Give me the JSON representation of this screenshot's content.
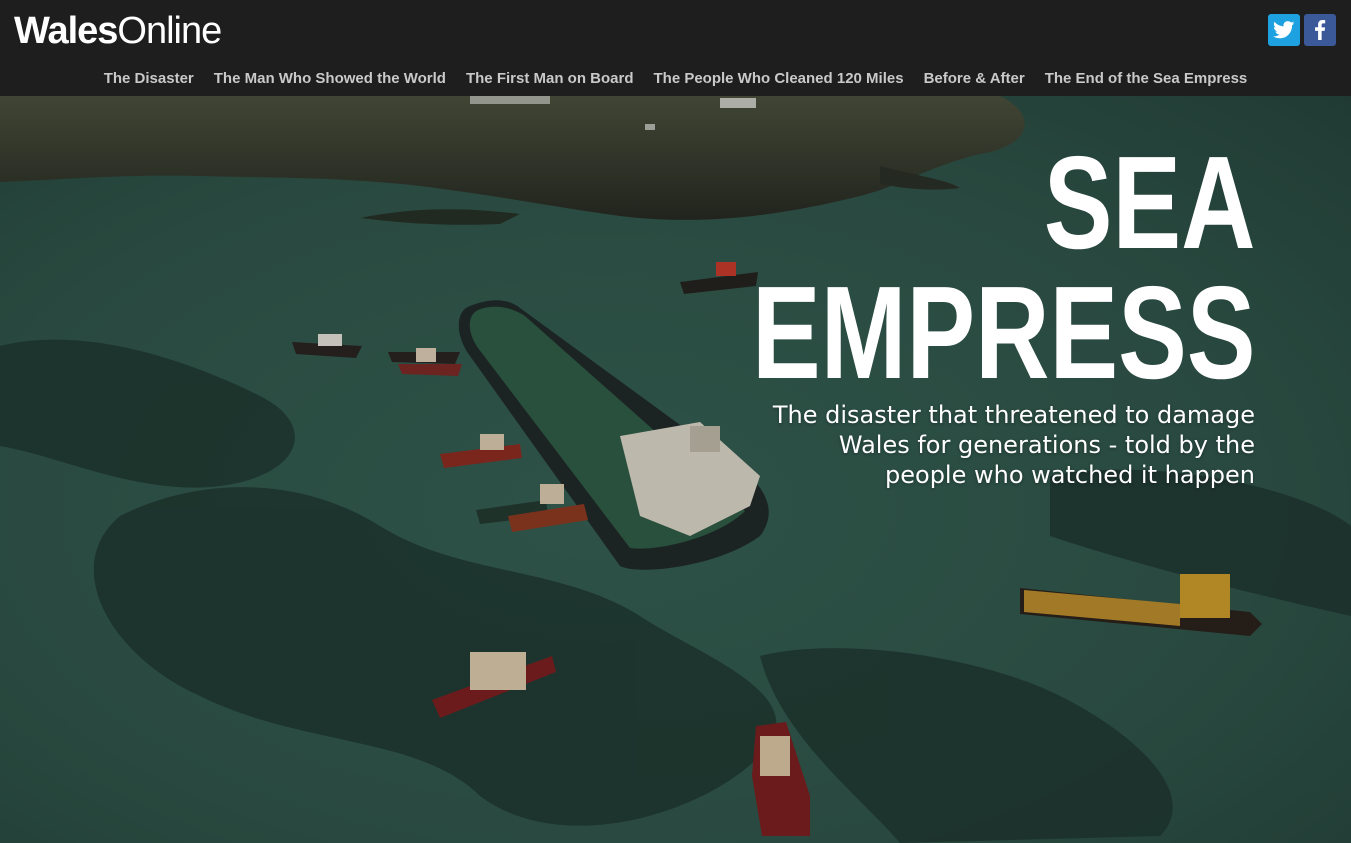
{
  "header": {
    "logo_bold": "Wales",
    "logo_light": "Online",
    "social": [
      {
        "name": "twitter",
        "icon": "twitter-icon",
        "color": "#1da1e0"
      },
      {
        "name": "facebook",
        "icon": "facebook-icon",
        "color": "#3b5998"
      }
    ]
  },
  "nav": {
    "items": [
      "The Disaster",
      "The Man Who Showed the World",
      "The First Man on Board",
      "The People Who Cleaned 120 Miles",
      "Before & After",
      "The End of the Sea Empress"
    ]
  },
  "hero": {
    "title_line1": "SEA",
    "title_line2": "EMPRESS",
    "subtitle": "The disaster that threatened to damage Wales for generations - told by the people who watched it happen",
    "image": "aerial-photo-tanker-and-tugboats-in-oil-slick"
  },
  "colors": {
    "header_bg": "#1e1e1e",
    "nav_text": "#c9c9c9",
    "sea": "#3f6b5c",
    "title_text": "#ffffff"
  }
}
